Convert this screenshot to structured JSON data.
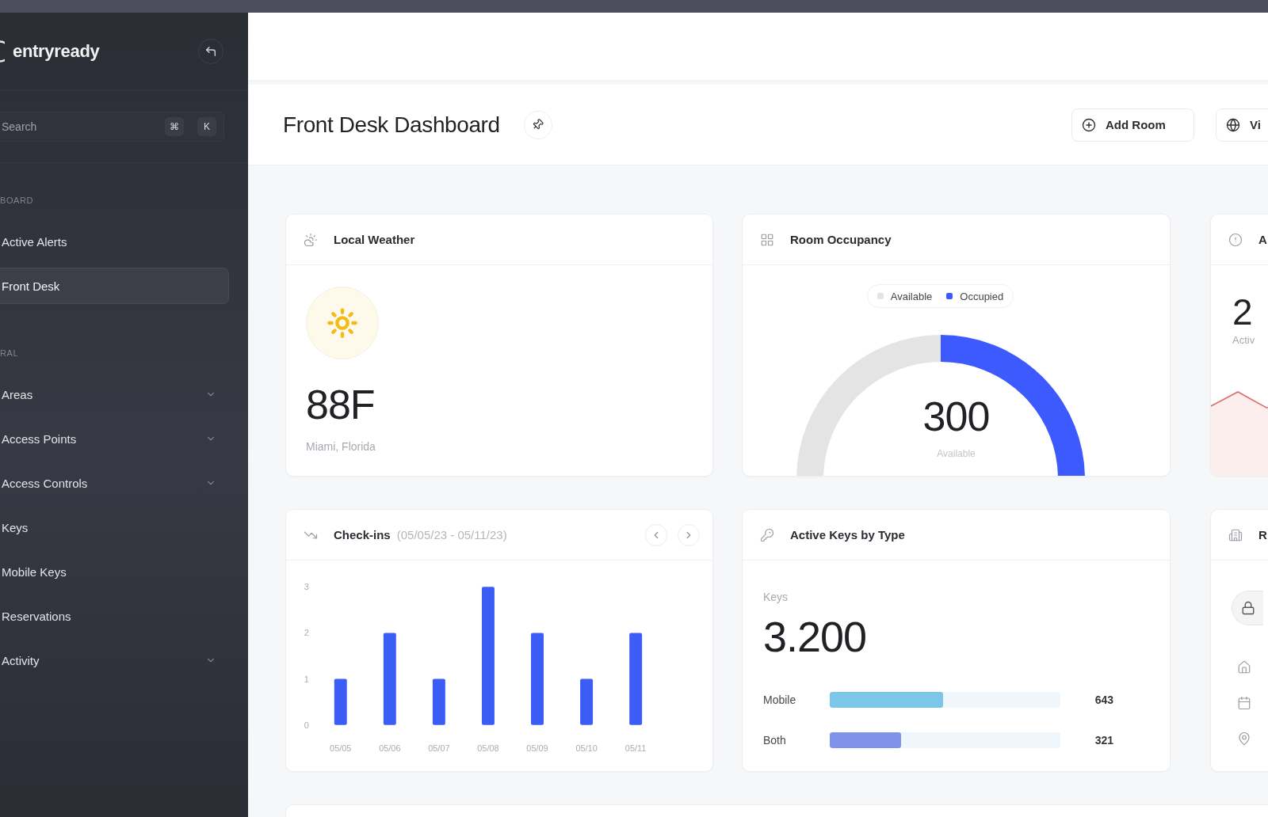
{
  "sidebar": {
    "brand": "entryready",
    "search": {
      "placeholder": "Search",
      "keys": [
        "⌘",
        "K"
      ]
    },
    "sections": [
      {
        "label": "BOARD",
        "items": [
          {
            "label": "Active Alerts",
            "selected": false,
            "expandable": false
          },
          {
            "label": "Front Desk",
            "selected": true,
            "expandable": false
          }
        ]
      },
      {
        "label": "RAL",
        "items": [
          {
            "label": "Areas",
            "selected": false,
            "expandable": true
          },
          {
            "label": "Access Points",
            "selected": false,
            "expandable": true
          },
          {
            "label": "Access Controls",
            "selected": false,
            "expandable": true
          },
          {
            "label": "Keys",
            "selected": false,
            "expandable": false
          },
          {
            "label": "Mobile Keys",
            "selected": false,
            "expandable": false
          },
          {
            "label": "Reservations",
            "selected": false,
            "expandable": false
          },
          {
            "label": "Activity",
            "selected": false,
            "expandable": true
          }
        ]
      }
    ]
  },
  "header": {
    "title": "Front Desk Dashboard",
    "buttons": [
      {
        "label": "Add Room",
        "kind": "add"
      },
      {
        "label": "Vi",
        "kind": "view"
      }
    ]
  },
  "weather": {
    "title": "Local Weather",
    "temperature": "88F",
    "location": "Miami, Florida"
  },
  "occupancy": {
    "title": "Room Occupancy",
    "legend": [
      {
        "label": "Available",
        "color": "#e4e4e4"
      },
      {
        "label": "Occupied",
        "color": "#3d5afe"
      }
    ],
    "value": "300",
    "caption": "Available"
  },
  "card_3": {
    "title": "A",
    "value": "2",
    "caption": "Activ"
  },
  "checkins": {
    "title": "Check-ins",
    "range": "(05/05/23 - 05/11/23)",
    "chart_data": {
      "type": "bar",
      "categories": [
        "05/05",
        "05/06",
        "05/07",
        "05/08",
        "05/09",
        "05/10",
        "05/11"
      ],
      "values": [
        1,
        2,
        1,
        3,
        2,
        1,
        2
      ],
      "ylim": [
        0,
        3
      ],
      "yticks": [
        0,
        1,
        2,
        3
      ]
    }
  },
  "keys_by_type": {
    "title": "Active Keys by Type",
    "label": "Keys",
    "total": "3.200",
    "rows": [
      {
        "label": "Mobile",
        "level": 0.49,
        "value": "643",
        "color": "#7cc6e8"
      },
      {
        "label": "Both",
        "level": 0.31,
        "value": "321",
        "color": "#8093ea"
      }
    ]
  },
  "card_6": {
    "title": "R"
  }
}
